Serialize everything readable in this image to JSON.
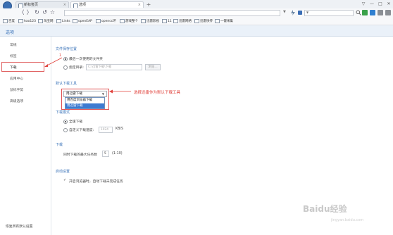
{
  "window": {
    "tabs": [
      {
        "label": "新标签页",
        "active": false
      },
      {
        "label": "选项",
        "active": true
      }
    ],
    "new_tab_label": "+",
    "controls": [
      "▽",
      "—",
      "□",
      "✕"
    ]
  },
  "nav": {
    "back": "〈",
    "forward": "〉",
    "refresh": "↻",
    "undo": "↺",
    "home": "☆",
    "addr_dropdown": "▼",
    "search_dropdown": "▼"
  },
  "bookmarks": [
    "百度",
    "hao123",
    "淘宝网",
    "Links",
    "openEAP",
    "opencc环",
    "游戏整个",
    "迅雷影视",
    "11",
    "迅雷网络",
    "迅雷快传",
    "一键采集"
  ],
  "options": {
    "title": "选项",
    "sidebar": {
      "items": [
        "常规",
        "标签",
        "下载",
        "应用中心",
        "鼠标手势",
        "高级选项"
      ],
      "active_index": 2,
      "reset_label": "恢复所有默认设置"
    },
    "save_location": {
      "heading": "文件保存位置",
      "option_last": "最后一次使用的文件夹",
      "option_custom": "指定目录:",
      "path_placeholder": "C:\\迅雷下载\\下载",
      "browse_label": "浏览..."
    },
    "default_tool": {
      "heading": "默认下载工具",
      "selected": "用迅雷下载",
      "options": [
        "用百度浏览器下载",
        "用迅雷下载"
      ],
      "highlighted_index": 1
    },
    "download_mode": {
      "heading": "下载模式",
      "option_full": "全速下载",
      "option_custom": "自定义下载速度:",
      "speed_value": "1024",
      "speed_unit": "KB/S"
    },
    "download": {
      "heading": "下载",
      "max_tasks_label": "同时下载的最大任务数",
      "max_tasks_value": "5",
      "max_tasks_range": "(1-10)"
    },
    "startup": {
      "heading": "启动设置",
      "resume_label": "开启浏览器时，自动下载未完成任务",
      "resume_checked": true,
      "check_mark": "✓"
    }
  },
  "annotations": {
    "marker_1": "1",
    "tip_text": "选择迅雷作为默认下载工具"
  },
  "watermark": {
    "brand": "Baidu经验",
    "url": "jingyan.baidu.com"
  },
  "colors": {
    "accent": "#3a73b9",
    "annotation": "#e0403a",
    "highlight": "#3d7bd1"
  }
}
